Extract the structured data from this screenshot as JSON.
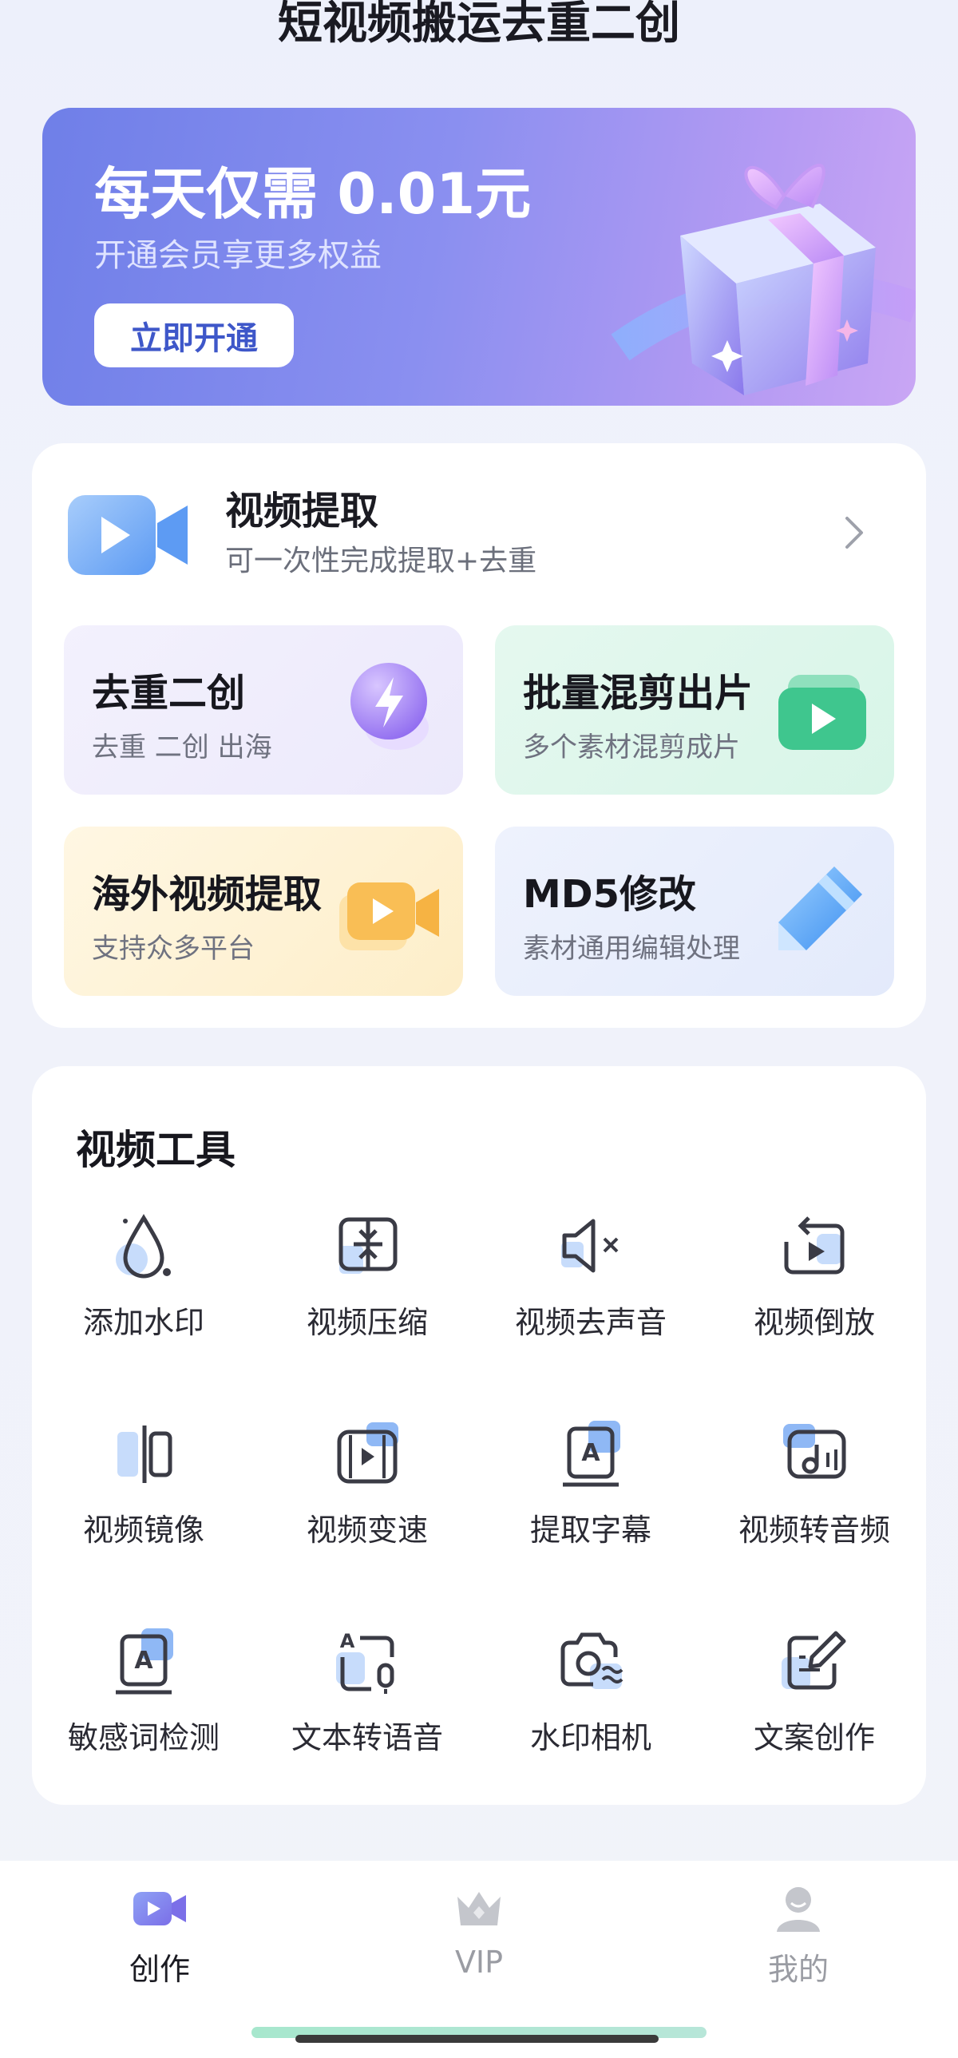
{
  "header": {
    "title": "短视频搬运去重二创"
  },
  "banner": {
    "title": "每天仅需 0.01元",
    "subtitle": "开通会员享更多权益",
    "button_label": "立即开通"
  },
  "extract": {
    "title": "视频提取",
    "subtitle": "可一次性完成提取+去重"
  },
  "tiles": [
    {
      "title": "去重二创",
      "subtitle": "去重  二创  出海",
      "icon": "lightning-icon"
    },
    {
      "title": "批量混剪出片",
      "subtitle": "多个素材混剪成片",
      "icon": "play-card-icon"
    },
    {
      "title": "海外视频提取",
      "subtitle": "支持众多平台",
      "icon": "video-camera-icon"
    },
    {
      "title": "MD5修改",
      "subtitle": "素材通用编辑处理",
      "icon": "pen-icon"
    }
  ],
  "tools": {
    "title": "视频工具",
    "items": [
      {
        "label": "添加水印",
        "icon": "water-drop-icon"
      },
      {
        "label": "视频压缩",
        "icon": "compress-icon"
      },
      {
        "label": "视频去声音",
        "icon": "mute-icon"
      },
      {
        "label": "视频倒放",
        "icon": "reverse-play-icon"
      },
      {
        "label": "视频镜像",
        "icon": "mirror-icon"
      },
      {
        "label": "视频变速",
        "icon": "film-speed-icon"
      },
      {
        "label": "提取字幕",
        "icon": "subtitle-icon"
      },
      {
        "label": "视频转音频",
        "icon": "music-note-icon"
      },
      {
        "label": "敏感词检测",
        "icon": "text-check-icon"
      },
      {
        "label": "文本转语音",
        "icon": "text-to-speech-icon"
      },
      {
        "label": "水印相机",
        "icon": "camera-icon"
      },
      {
        "label": "文案创作",
        "icon": "edit-icon"
      }
    ]
  },
  "tabbar": {
    "tabs": [
      {
        "label": "创作",
        "icon": "video-create-icon",
        "active": true
      },
      {
        "label": "VIP",
        "icon": "crown-icon",
        "active": false
      },
      {
        "label": "我的",
        "icon": "user-icon",
        "active": false
      }
    ]
  },
  "colors": {
    "accent": "#3e57c9",
    "banner_start": "#6f7fe8",
    "banner_end": "#c9a6f4",
    "icon_blue": "#7fb1f4",
    "text_primary": "#1b1b22",
    "text_secondary": "#6b6f7b",
    "tab_inactive": "#9a9ca3"
  }
}
